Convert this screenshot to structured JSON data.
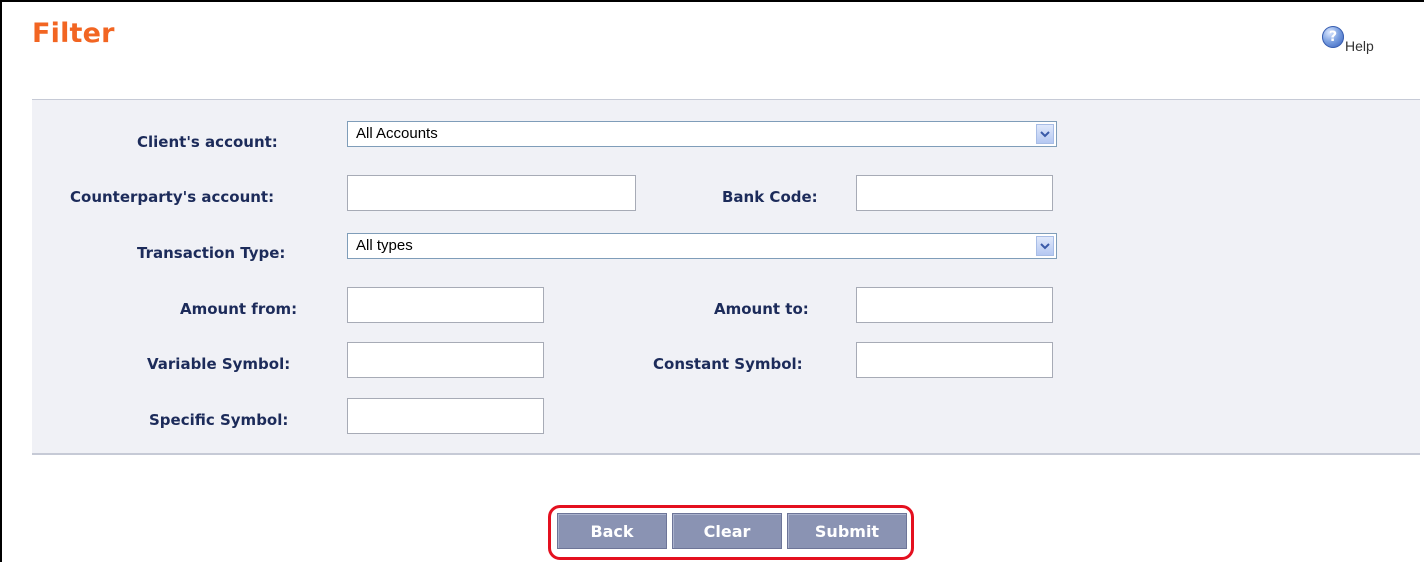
{
  "page": {
    "title": "Filter"
  },
  "help": {
    "label": "Help",
    "icon": "help-question-icon"
  },
  "form": {
    "client_account": {
      "label": "Client's account:",
      "value": "All Accounts"
    },
    "counterparty_account": {
      "label": "Counterparty's account:",
      "value": ""
    },
    "bank_code": {
      "label": "Bank Code:",
      "value": ""
    },
    "transaction_type": {
      "label": "Transaction Type:",
      "value": "All types"
    },
    "amount_from": {
      "label": "Amount from:",
      "value": ""
    },
    "amount_to": {
      "label": "Amount to:",
      "value": ""
    },
    "variable_symbol": {
      "label": "Variable Symbol:",
      "value": ""
    },
    "constant_symbol": {
      "label": "Constant Symbol:",
      "value": ""
    },
    "specific_symbol": {
      "label": "Specific Symbol:",
      "value": ""
    }
  },
  "buttons": {
    "back": "Back",
    "clear": "Clear",
    "submit": "Submit"
  },
  "colors": {
    "title": "#f26522",
    "label": "#1c2b5a",
    "panel_bg": "#f0f1f6",
    "button_bg": "#8a93b3",
    "highlight": "#e4101f"
  }
}
